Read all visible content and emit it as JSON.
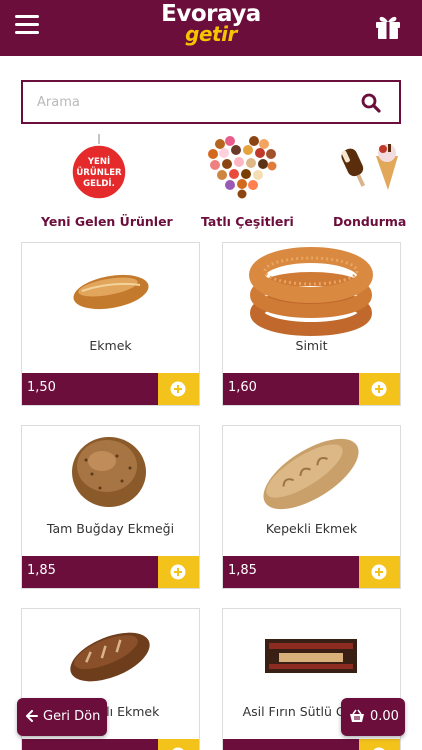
{
  "header": {
    "logo_line1": "Evoraya",
    "logo_line2": "getir",
    "menu_icon": "hamburger-icon",
    "gift_icon": "gift-icon"
  },
  "search": {
    "placeholder": "Arama",
    "value": "",
    "icon": "search-icon"
  },
  "categories": [
    {
      "label": "Yeni Gelen Ürünler",
      "badge_lines": [
        "YENİ",
        "ÜRÜNLER",
        "GELDİ."
      ]
    },
    {
      "label": "Tatlı Çeşitleri"
    },
    {
      "label": "Dondurma"
    }
  ],
  "products": [
    {
      "name": "Ekmek",
      "price": "1,50"
    },
    {
      "name": "Simit",
      "price": "1,60"
    },
    {
      "name": "Tam Buğday Ekmeği",
      "price": "1,85"
    },
    {
      "name": "Kepekli Ekmek",
      "price": "1,85"
    },
    {
      "name": "Çavdarlı Ekmek",
      "price": ""
    },
    {
      "name": "Asil Fırın Sütlü Gevrek",
      "price": ""
    }
  ],
  "bottom": {
    "back_label": "Geri Dön",
    "cart_total": "0.00"
  },
  "colors": {
    "primary": "#6b0e3c",
    "accent": "#f3c21b",
    "badge_red": "#e42a2a"
  }
}
